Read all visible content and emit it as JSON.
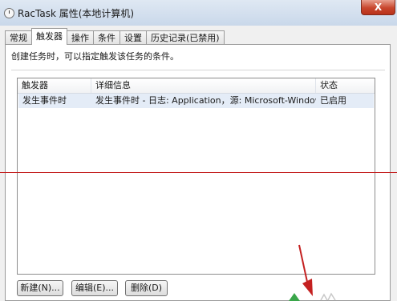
{
  "window": {
    "title": "RacTask 属性(本地计算机)",
    "close_label": "X"
  },
  "tabs": [
    {
      "label": "常规",
      "active": false
    },
    {
      "label": "触发器",
      "active": true
    },
    {
      "label": "操作",
      "active": false
    },
    {
      "label": "条件",
      "active": false
    },
    {
      "label": "设置",
      "active": false
    },
    {
      "label": "历史记录(已禁用)",
      "active": false
    }
  ],
  "triggers": {
    "description": "创建任务时，可以指定触发该任务的条件。",
    "columns": [
      "触发器",
      "详细信息",
      "状态"
    ],
    "rows": [
      {
        "trigger": "发生事件时",
        "details": "发生事件时 - 日志: Application，源: Microsoft-Windows-CEI...",
        "status": "已启用"
      }
    ]
  },
  "buttons": {
    "new": "新建(N)...",
    "edit": "编辑(E)...",
    "delete": "删除(D)"
  },
  "annotation_colors": {
    "red_line": "#c42020",
    "arrow": "#c42020",
    "green_mark": "#3aa64a"
  }
}
